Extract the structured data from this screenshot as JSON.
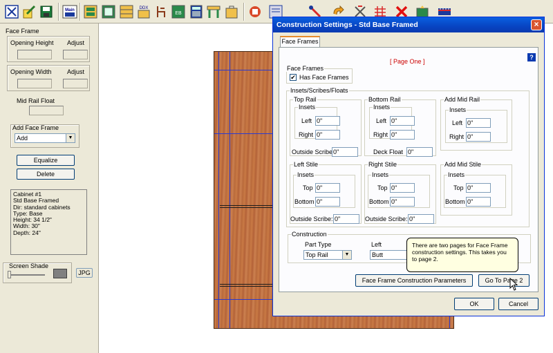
{
  "toolbar": {
    "buttons": [
      {
        "icon": "select-icon"
      },
      {
        "icon": "edit-icon"
      },
      {
        "icon": "save-icon"
      },
      {
        "icon": "main-icon",
        "label": "Main"
      },
      {
        "icon": "cabinet-icon"
      },
      {
        "icon": "cabinet-icon"
      },
      {
        "icon": "drawer-icon"
      },
      {
        "icon": "door-icon",
        "label": "DDX"
      },
      {
        "icon": "chair-icon"
      },
      {
        "icon": "elevation-icon",
        "label": "EB"
      },
      {
        "icon": "calculator-icon"
      },
      {
        "icon": "table-icon"
      },
      {
        "icon": "bag-icon"
      },
      {
        "icon": "report-icon"
      },
      {
        "icon": "settings-icon"
      },
      {
        "icon": "pointer-icon"
      },
      {
        "icon": "redo-icon"
      },
      {
        "icon": "tools-icon"
      },
      {
        "icon": "grid-icon"
      },
      {
        "icon": "close-x-icon"
      },
      {
        "icon": "export-icon"
      },
      {
        "icon": "ruler-icon"
      }
    ]
  },
  "left_panel": {
    "section_title": "Face Frame",
    "opening_height_label": "Opening Height",
    "adjust_label_1": "Adjust",
    "opening_width_label": "Opening Width",
    "adjust_label_2": "Adjust",
    "mid_rail_float_label": "Mid Rail Float",
    "add_face_frame_label": "Add Face Frame",
    "add_face_frame_value": "Add",
    "equalize_label": "Equalize",
    "delete_label": "Delete",
    "info_lines": [
      "Cabinet #1",
      "Std Base Framed",
      "Dir: standard cabinets",
      "Type: Base",
      "Height: 34 1/2\"",
      "Width: 30\"",
      "Depth: 24\""
    ],
    "screen_shade_label": "Screen Shade",
    "jpg_label": "JPG"
  },
  "dialog": {
    "title": "Construction Settings - Std Base Framed",
    "tab_label": "Face Frames",
    "page_label": "[ Page One ]",
    "help_label": "?",
    "face_frames_group": "Face Frames",
    "has_face_frames_label": "Has Face Frames",
    "has_face_frames_checked": "✔",
    "insets_group": "Insets/Scribes/Floats",
    "top_rail": {
      "title": "Top Rail",
      "insets": "Insets",
      "left_label": "Left",
      "left_value": "0\"",
      "right_label": "Right",
      "right_value": "0\"",
      "scribe_label": "Outside Scribe",
      "scribe_value": "0\""
    },
    "bottom_rail": {
      "title": "Bottom Rail",
      "insets": "Insets",
      "left_label": "Left",
      "left_value": "0\"",
      "right_label": "Right",
      "right_value": "0\"",
      "float_label": "Deck Float",
      "float_value": "0\""
    },
    "add_mid_rail": {
      "title": "Add Mid Rail",
      "insets": "Insets",
      "left_label": "Left",
      "left_value": "0\"",
      "right_label": "Right",
      "right_value": "0\""
    },
    "left_stile": {
      "title": "Left Stile",
      "insets": "Insets",
      "top_label": "Top",
      "top_value": "0\"",
      "bottom_label": "Bottom",
      "bottom_value": "0\"",
      "scribe_label": "Outside Scribe:",
      "scribe_value": "0\""
    },
    "right_stile": {
      "title": "Right Stile",
      "insets": "Insets",
      "top_label": "Top",
      "top_value": "0\"",
      "bottom_label": "Bottom",
      "bottom_value": "0\"",
      "scribe_label": "Outside Scribe:",
      "scribe_value": "0\""
    },
    "add_mid_stile": {
      "title": "Add Mid Stile",
      "insets": "Insets",
      "top_label": "Top",
      "top_value": "0\"",
      "bottom_label": "Bottom",
      "bottom_value": "0\""
    },
    "construction": {
      "title": "Construction",
      "part_type_label": "Part Type",
      "part_type_value": "Top Rail",
      "left_label": "Left",
      "left_value": "Butt"
    },
    "ff_params_label": "Face Frame Construction Parameters",
    "go_to_page_label": "Go To Page 2",
    "ok_label": "OK",
    "cancel_label": "Cancel"
  },
  "tooltip": {
    "text": "There are two pages for Face Frame construction settings. This takes you to page 2."
  },
  "colors": {
    "title_bar": "#0844c2",
    "page_label": "#cc0000",
    "wood": "#c97a45"
  }
}
